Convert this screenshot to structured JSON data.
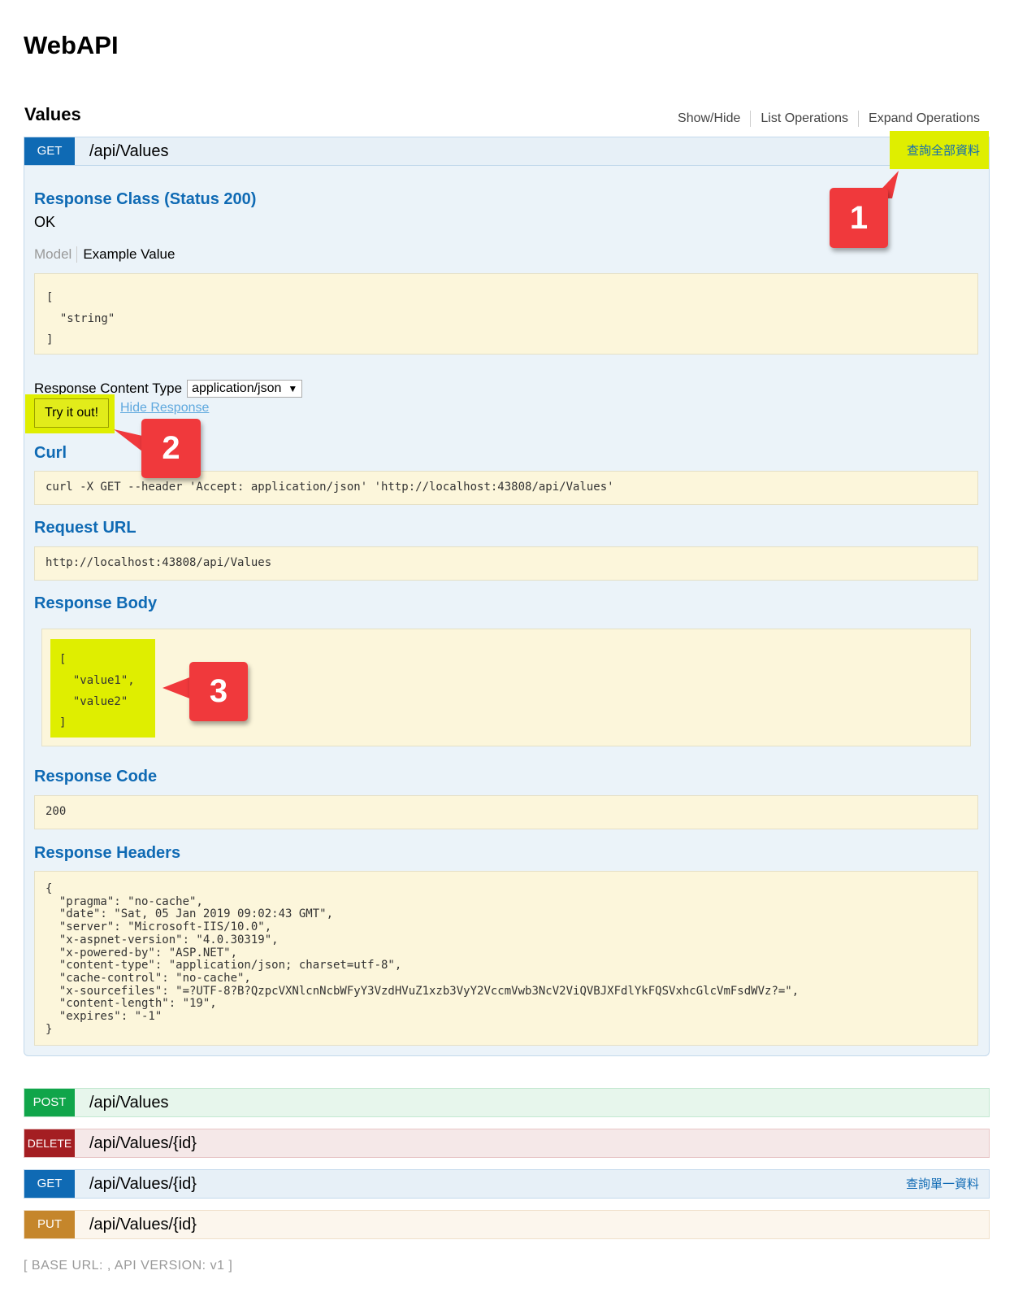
{
  "app": {
    "title": "WebAPI"
  },
  "section": {
    "title": "Values",
    "links": [
      "Show/Hide",
      "List Operations",
      "Expand Operations"
    ]
  },
  "operations": [
    {
      "method": "GET",
      "path": "/api/Values",
      "summary": "查詢全部資料"
    },
    {
      "method": "POST",
      "path": "/api/Values",
      "summary": ""
    },
    {
      "method": "DELETE",
      "path": "/api/Values/{id}",
      "summary": ""
    },
    {
      "method": "GET",
      "path": "/api/Values/{id}",
      "summary": "查詢單一資料"
    },
    {
      "method": "PUT",
      "path": "/api/Values/{id}",
      "summary": ""
    }
  ],
  "detail": {
    "response_class_title": "Response Class (Status 200)",
    "response_class_value": "OK",
    "model_tab": "Model",
    "example_tab": "Example Value",
    "example_value": "[\n  \"string\"\n]",
    "content_type_label": "Response Content Type",
    "content_type_value": "application/json",
    "try_button": "Try it out!",
    "hide_response": "Hide Response",
    "curl_title": "Curl",
    "curl_value": "curl -X GET --header 'Accept: application/json' 'http://localhost:43808/api/Values'",
    "request_url_title": "Request URL",
    "request_url_value": "http://localhost:43808/api/Values",
    "response_body_title": "Response Body",
    "response_body_value": "[\n  \"value1\",\n  \"value2\"\n]",
    "response_code_title": "Response Code",
    "response_code_value": "200",
    "response_headers_title": "Response Headers",
    "response_headers_value": "{\n  \"pragma\": \"no-cache\",\n  \"date\": \"Sat, 05 Jan 2019 09:02:43 GMT\",\n  \"server\": \"Microsoft-IIS/10.0\",\n  \"x-aspnet-version\": \"4.0.30319\",\n  \"x-powered-by\": \"ASP.NET\",\n  \"content-type\": \"application/json; charset=utf-8\",\n  \"cache-control\": \"no-cache\",\n  \"x-sourcefiles\": \"=?UTF-8?B?QzpcVXNlcnNcbWFyY3VzdHVuZ1xzb3VyY2VccmVwb3NcV2ViQVBJXFdlYkFQSVxhcGlcVmFsdWVz?=\",\n  \"content-length\": \"19\",\n  \"expires\": \"-1\"\n}"
  },
  "callouts": [
    "1",
    "2",
    "3"
  ],
  "footer": {
    "text": "[ BASE URL: , API VERSION: v1 ]"
  },
  "colors": {
    "get": "#0f6ab4",
    "post": "#10a54a",
    "delete": "#a41e22",
    "put": "#c5862b",
    "highlight": "#dfee00",
    "callout": "#f0393c",
    "snippet_bg": "#fcf6db"
  }
}
